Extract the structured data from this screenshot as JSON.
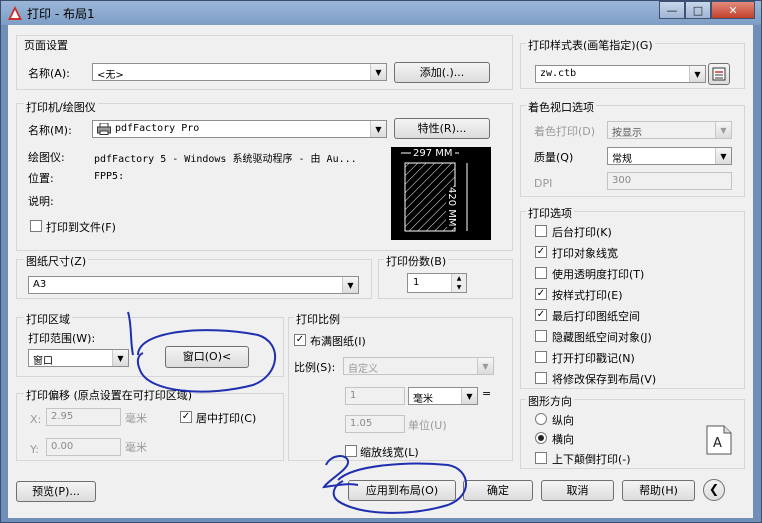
{
  "window": {
    "title": "打印 - 布局1",
    "close_glyph": "✕",
    "min_glyph": "—",
    "max_glyph": "□"
  },
  "page_setup": {
    "heading": "页面设置",
    "name_label": "名称(A):",
    "name_value": "<无>",
    "add_button": "添加(.)..."
  },
  "printer": {
    "heading": "打印机/绘图仪",
    "name_label": "名称(M):",
    "name_value": "pdfFactory Pro",
    "properties_button": "特性(R)...",
    "plotter_label": "绘图仪:",
    "plotter_value": "pdfFactory 5 - Windows 系统驱动程序 - 由 Au...",
    "location_label": "位置:",
    "location_value": "FPP5:",
    "desc_label": "说明:",
    "print_to_file": "打印到文件(F)",
    "preview_width": "297 MM",
    "preview_height": "420 MM"
  },
  "paper_size": {
    "heading": "图纸尺寸(Z)",
    "value": "A3"
  },
  "copies": {
    "heading": "打印份数(B)",
    "value": "1"
  },
  "plot_area": {
    "heading": "打印区域",
    "range_label": "打印范围(W):",
    "range_value": "窗口",
    "window_button": "窗口(O)<"
  },
  "plot_offset": {
    "heading": "打印偏移 (原点设置在可打印区域)",
    "x_label": "X:",
    "x_value": "2.95",
    "x_unit": "毫米",
    "y_label": "Y:",
    "y_value": "0.00",
    "y_unit": "毫米",
    "center": "居中打印(C)"
  },
  "plot_scale": {
    "heading": "打印比例",
    "fit": "布满图纸(I)",
    "scale_label": "比例(S):",
    "scale_value": "自定义",
    "val1": "1",
    "unit1": "毫米",
    "equals": "=",
    "val2": "1.05",
    "unit2": "单位(U)",
    "lineweights": "缩放线宽(L)"
  },
  "style_table": {
    "heading": "打印样式表(画笔指定)(G)",
    "value": "zw.ctb"
  },
  "shaded": {
    "heading": "着色视口选项",
    "shade_label": "着色打印(D)",
    "shade_value": "按显示",
    "quality_label": "质量(Q)",
    "quality_value": "常规",
    "dpi_label": "DPI",
    "dpi_value": "300"
  },
  "options": {
    "heading": "打印选项",
    "items": [
      {
        "label": "后台打印(K)",
        "checked": false
      },
      {
        "label": "打印对象线宽",
        "checked": true
      },
      {
        "label": "使用透明度打印(T)",
        "checked": false
      },
      {
        "label": "按样式打印(E)",
        "checked": true
      },
      {
        "label": "最后打印图纸空间",
        "checked": true
      },
      {
        "label": "隐藏图纸空间对象(J)",
        "checked": false
      },
      {
        "label": "打开打印戳记(N)",
        "checked": false
      },
      {
        "label": "将修改保存到布局(V)",
        "checked": false
      }
    ]
  },
  "orientation": {
    "heading": "图形方向",
    "portrait": "纵向",
    "landscape": "横向",
    "upside_down": "上下颠倒打印(-)"
  },
  "footer": {
    "preview": "预览(P)...",
    "apply": "应用到布局(O)",
    "ok": "确定",
    "cancel": "取消",
    "help": "帮助(H)"
  },
  "colors": {
    "annotation": "#1f2fb0",
    "titlebar": "#8aa7cf"
  }
}
